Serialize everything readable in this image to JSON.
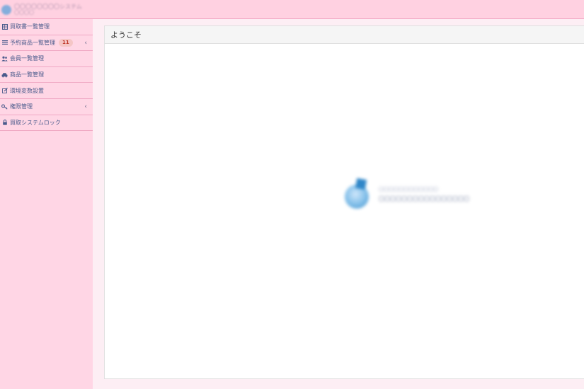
{
  "header": {
    "brand_line1": "〇〇〇〇〇〇〇〇システム",
    "brand_line2": "〇〇〇〇"
  },
  "sidebar": {
    "items": [
      {
        "label": "買取書一覧管理",
        "icon": "table-icon"
      },
      {
        "label": "予約商品一覧管理",
        "icon": "list-icon",
        "badge": "11",
        "has_chevron": true
      },
      {
        "label": "会員一覧管理",
        "icon": "users-icon"
      },
      {
        "label": "商品一覧管理",
        "icon": "car-icon"
      },
      {
        "label": "環境変数設置",
        "icon": "edit-icon"
      },
      {
        "label": "権限管理",
        "icon": "key-icon",
        "has_chevron": true
      },
      {
        "label": "買取システムロック",
        "icon": "lock-icon"
      }
    ]
  },
  "main": {
    "panel_title": "ようこそ",
    "logo_line1": "〇〇〇〇〇〇〇〇〇〇〇〇",
    "logo_line2": "〇〇〇〇〇〇〇〇〇〇〇〇〇〇〇〇"
  },
  "colors": {
    "topbar": "#ffd1e1",
    "sidebar": "#ffd6e5",
    "menu_text": "#4a5b8c",
    "badge_text": "#c0392b"
  }
}
